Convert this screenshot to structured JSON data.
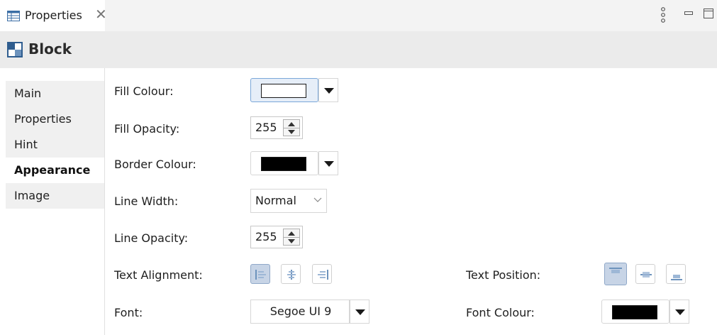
{
  "view_tab": {
    "label": "Properties",
    "close": "✕"
  },
  "title": "Block",
  "side_tabs": [
    {
      "label": "Main",
      "active": false
    },
    {
      "label": "Properties",
      "active": false
    },
    {
      "label": "Hint",
      "active": false
    },
    {
      "label": "Appearance",
      "active": true
    },
    {
      "label": "Image",
      "active": false
    }
  ],
  "form": {
    "fill_colour": {
      "label": "Fill Colour:",
      "value": "#ffffff"
    },
    "fill_opacity": {
      "label": "Fill Opacity:",
      "value": "255"
    },
    "border_colour": {
      "label": "Border Colour:",
      "value": "#000000"
    },
    "line_width": {
      "label": "Line Width:",
      "value": "Normal"
    },
    "line_opacity": {
      "label": "Line Opacity:",
      "value": "255"
    },
    "text_alignment": {
      "label": "Text Alignment:",
      "options": [
        "left",
        "center",
        "right"
      ],
      "selected": "left"
    },
    "text_position": {
      "label": "Text Position:",
      "options": [
        "top",
        "middle",
        "bottom"
      ],
      "selected": "top"
    },
    "font": {
      "label": "Font:",
      "value": "Segoe UI 9"
    },
    "font_colour": {
      "label": "Font Colour:",
      "value": "#000000"
    }
  },
  "icons": {
    "view_menu": "vertical-dots-icon",
    "minimize": "minimize-icon",
    "maximize": "maximize-icon",
    "view_tab": "table-icon",
    "title": "block-icon"
  },
  "colors": {
    "accent": "#7aa7d9",
    "selected_button": "#c7d4e6",
    "icon_blue": "#2f5d8f"
  }
}
